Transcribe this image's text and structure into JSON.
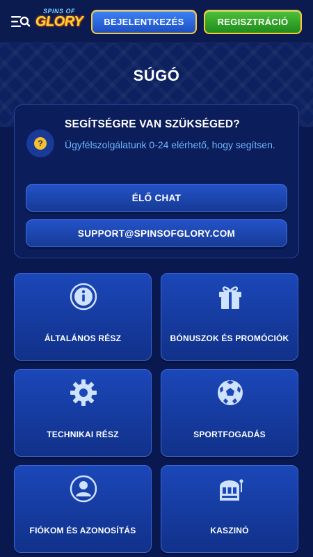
{
  "header": {
    "logo": {
      "line1": "SPINS OF",
      "line2": "GLORY"
    },
    "login_label": "BEJELENTKEZÉS",
    "register_label": "REGISZTRÁCIÓ"
  },
  "page": {
    "title": "SÚGÓ"
  },
  "help": {
    "heading": "SEGÍTSÉGRE VAN SZÜKSÉGED?",
    "text": "Ügyfélszolgálatunk 0-24 elérhető, hogy segítsen.",
    "question_mark": "?",
    "chat_label": "ÉLŐ CHAT",
    "email_label": "SUPPORT@SPINSOFGLORY.COM"
  },
  "categories": [
    {
      "label": "ÁLTALÁNOS RÉSZ",
      "icon": "info-icon"
    },
    {
      "label": "BÓNUSZOK ÉS PROMÓCIÓK",
      "icon": "gift-icon"
    },
    {
      "label": "TECHNIKAI RÉSZ",
      "icon": "gear-icon"
    },
    {
      "label": "SPORTFOGADÁS",
      "icon": "soccer-ball-icon"
    },
    {
      "label": "FIÓKOM ÉS AZONOSÍTÁS",
      "icon": "user-icon"
    },
    {
      "label": "KASZINÓ",
      "icon": "slot-machine-icon"
    }
  ],
  "colors": {
    "background": "#0a1850",
    "accent_gold": "#ffc83a",
    "login_blue": "#2f6ee6",
    "register_green": "#3aa82e",
    "link_text": "#6fb8ff"
  }
}
